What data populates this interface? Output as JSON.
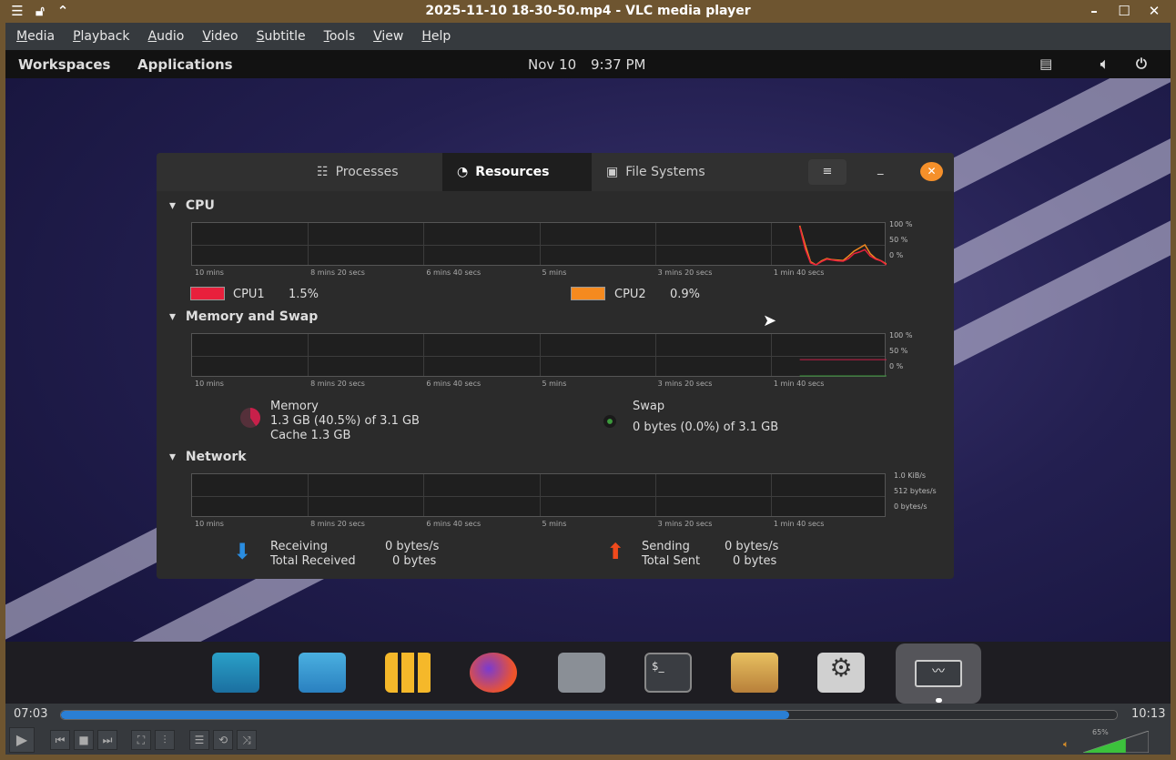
{
  "window": {
    "title": "2025-11-10 18-30-50.mp4 - VLC media player"
  },
  "menu": [
    "Media",
    "Playback",
    "Audio",
    "Video",
    "Subtitle",
    "Tools",
    "View",
    "Help"
  ],
  "panel": {
    "workspaces": "Workspaces",
    "applications": "Applications",
    "date": "Nov 10",
    "time": "9:37 PM"
  },
  "monitor": {
    "tabs": [
      "Processes",
      "Resources",
      "File Systems"
    ],
    "active_tab": "Resources",
    "time_ticks": [
      "10 mins",
      "8 mins 20 secs",
      "6 mins 40 secs",
      "5 mins",
      "3 mins 20 secs",
      "1 min 40 secs"
    ],
    "cpu": {
      "title": "CPU",
      "axis": [
        "100 %",
        "50 %",
        "0 %"
      ],
      "cpu1": {
        "label": "CPU1",
        "value": "1.5%",
        "color": "#e8203c",
        "history": [
          95,
          40,
          5,
          0,
          8,
          14,
          12,
          10,
          9,
          16,
          28,
          32,
          38,
          22,
          14,
          10,
          0
        ]
      },
      "cpu2": {
        "label": "CPU2",
        "value": "0.9%",
        "color": "#f58a1f",
        "history": [
          98,
          50,
          8,
          0,
          10,
          16,
          13,
          12,
          11,
          22,
          34,
          42,
          50,
          28,
          16,
          10,
          2
        ]
      }
    },
    "memory": {
      "title": "Memory and Swap",
      "axis": [
        "100 %",
        "50 %",
        "0 %"
      ],
      "mem_label": "Memory",
      "mem_value": "1.3 GB (40.5%) of 3.1 GB",
      "cache": "Cache 1.3 GB",
      "mem_percent": 40.5,
      "swap_label": "Swap",
      "swap_value": "0 bytes (0.0%) of 3.1 GB",
      "swap_percent": 0
    },
    "network": {
      "title": "Network",
      "axis": [
        "1.0 KiB/s",
        "512 bytes/s",
        "0 bytes/s"
      ],
      "recv_label": "Receiving",
      "recv_value": "0 bytes/s",
      "total_recv_label": "Total Received",
      "total_recv_value": "0 bytes",
      "send_label": "Sending",
      "send_value": "0 bytes/s",
      "total_sent_label": "Total Sent",
      "total_sent_value": "0 bytes"
    }
  },
  "player": {
    "elapsed": "07:03",
    "total": "10:13",
    "progress_percent": 69,
    "volume": "65%",
    "volume_percent": 65
  }
}
